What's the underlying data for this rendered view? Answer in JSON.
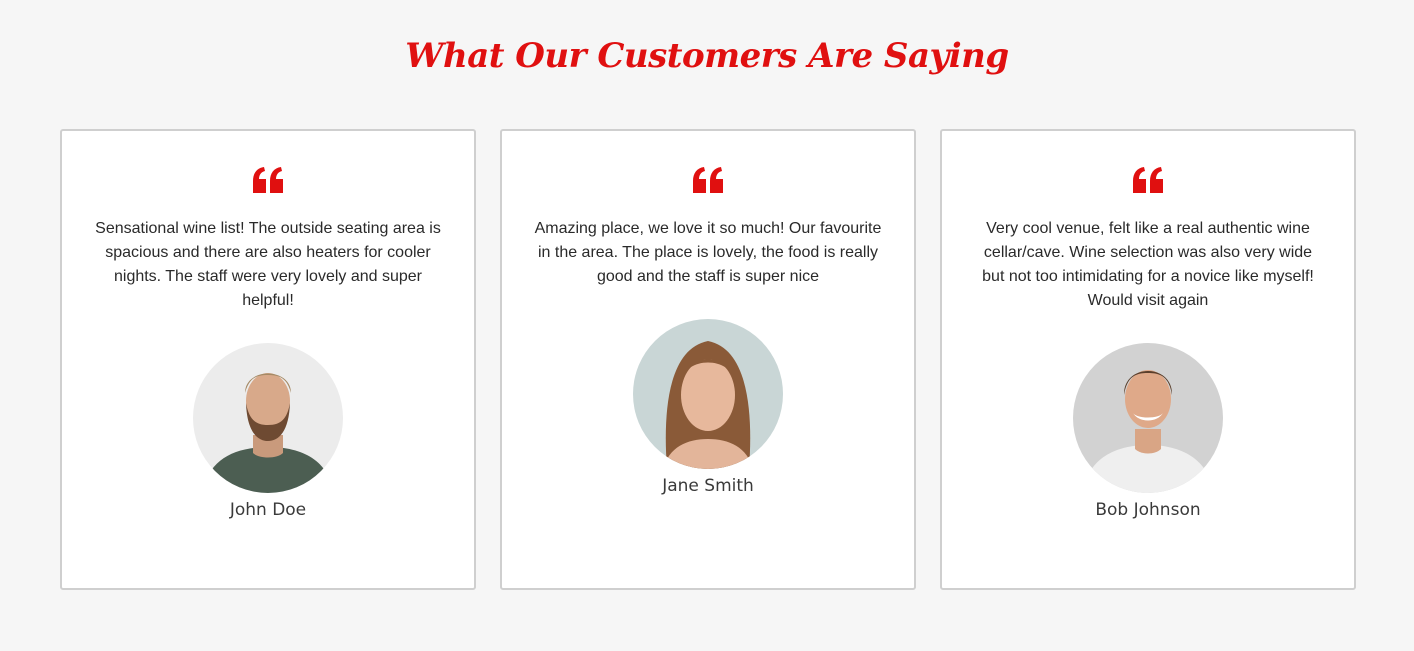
{
  "section": {
    "title": "What Our Customers Are Saying"
  },
  "colors": {
    "accent": "#e01010",
    "background": "#f6f6f6",
    "card_border": "#cfcfcf"
  },
  "testimonials": [
    {
      "icon": "quote-icon",
      "text": "Sensational wine list! The outside seating area is spacious and there are also heaters for cooler nights. The staff were very lovely and super helpful!",
      "name": "John Doe"
    },
    {
      "icon": "quote-icon",
      "text": "Amazing place, we love it so much! Our favourite in the area. The place is lovely, the food is really good and the staff is super nice",
      "name": "Jane Smith"
    },
    {
      "icon": "quote-icon",
      "text": "Very cool venue, felt like a real authentic wine cellar/cave. Wine selection was also very wide but not too intimidating for a novice like myself! Would visit again",
      "name": "Bob Johnson"
    }
  ]
}
